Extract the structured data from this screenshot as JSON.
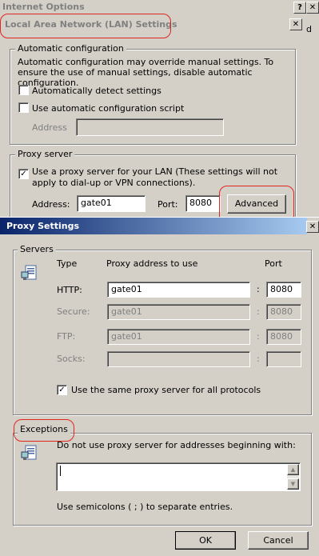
{
  "internet_options": {
    "title": "Internet Options",
    "help_btn": "?",
    "close_btn": "✕"
  },
  "lan_dialog": {
    "title": "Local Area Network (LAN) Settings",
    "tab_fragment": "d",
    "close_btn": "✕",
    "auto_config": {
      "legend": "Automatic configuration",
      "description": "Automatic configuration may override manual settings.  To ensure the use of manual settings, disable automatic configuration.",
      "auto_detect_label": "Automatically detect settings",
      "auto_detect_checked": false,
      "use_script_label": "Use automatic configuration script",
      "use_script_checked": false,
      "address_label": "Address",
      "address_value": ""
    },
    "proxy_server": {
      "legend": "Proxy server",
      "use_proxy_label": "Use a proxy server for your LAN (These settings will not apply to dial-up or VPN connections).",
      "use_proxy_checked": true,
      "checkmark": "✓",
      "address_label": "Address:",
      "address_value": "gate01",
      "port_label": "Port:",
      "port_value": "8080",
      "advanced_button": "Advanced"
    }
  },
  "proxy_settings": {
    "title": "Proxy Settings",
    "close_btn": "✕",
    "servers": {
      "legend": "Servers",
      "col_type": "Type",
      "col_address": "Proxy address to use",
      "col_port": "Port",
      "colon": ":",
      "rows": [
        {
          "type": "HTTP:",
          "address": "gate01",
          "port": "8080",
          "enabled": true
        },
        {
          "type": "Secure:",
          "address": "gate01",
          "port": "8080",
          "enabled": false
        },
        {
          "type": "FTP:",
          "address": "gate01",
          "port": "8080",
          "enabled": false
        },
        {
          "type": "Socks:",
          "address": "",
          "port": "",
          "enabled": false
        }
      ],
      "same_proxy_label": "Use the same proxy server for all protocols",
      "same_proxy_checked": true
    },
    "exceptions": {
      "legend": "Exceptions",
      "description": "Do not use proxy server for addresses beginning with:",
      "value": "",
      "hint": "Use semicolons ( ; ) to separate entries.",
      "scroll_up": "▲",
      "scroll_down": "▼"
    },
    "ok_button": "OK",
    "cancel_button": "Cancel"
  }
}
